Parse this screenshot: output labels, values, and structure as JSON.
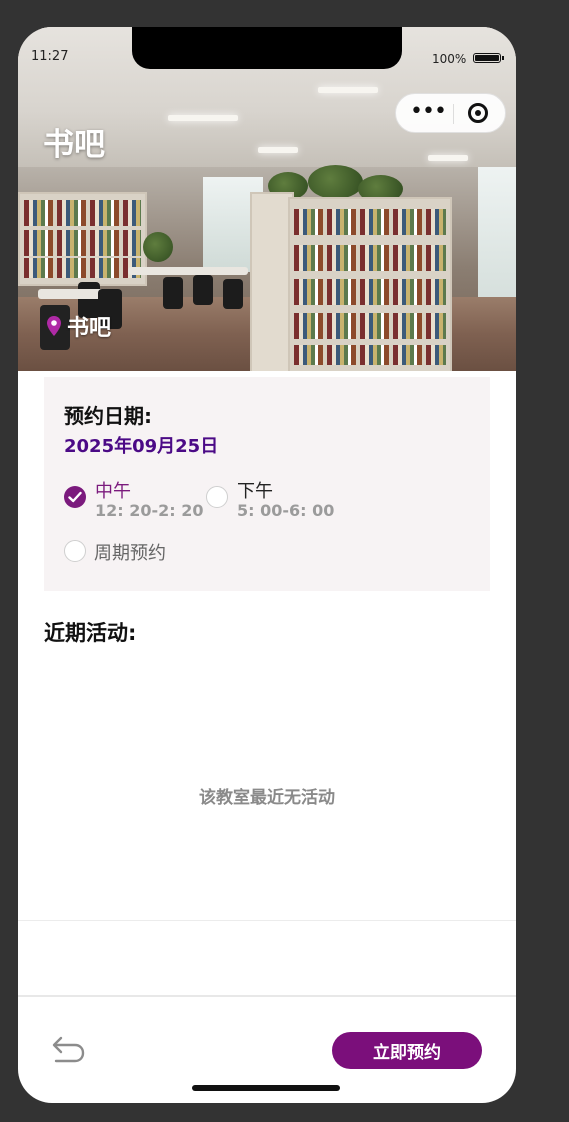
{
  "status_bar": {
    "time": "11:27",
    "battery": "100%"
  },
  "header": {
    "title": "书吧",
    "location": "书吧",
    "image_icon": "library-photo"
  },
  "booking": {
    "date_label": "预约日期:",
    "date_value": "2025年09月25日",
    "slots": [
      {
        "name": "中午",
        "time": "12: 20-2: 20",
        "selected": true
      },
      {
        "name": "下午",
        "time": "5: 00-6:  00",
        "selected": false
      }
    ],
    "periodic_label": "周期预约",
    "periodic_selected": false
  },
  "activities": {
    "title": "近期活动:",
    "empty_text": "该教室最近无活动"
  },
  "footer": {
    "reserve_label": "立即预约",
    "back_icon": "back-arrow-icon"
  },
  "colors": {
    "accent": "#7b0f7b",
    "date_text": "#4b0a86",
    "card_bg": "#f7f3f4"
  }
}
